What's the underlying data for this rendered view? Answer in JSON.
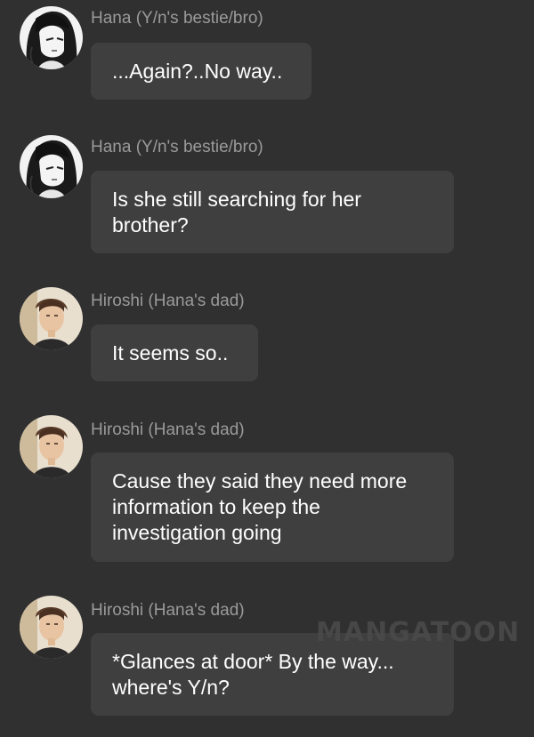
{
  "messages": [
    {
      "sender": "Hana (Y/n's bestie/bro)",
      "avatar_icon": "girl-avatar-icon",
      "text": "...Again?..No way.."
    },
    {
      "sender": "Hana (Y/n's bestie/bro)",
      "avatar_icon": "girl-avatar-icon",
      "text": "Is she still searching for her brother?"
    },
    {
      "sender": "Hiroshi (Hana's dad)",
      "avatar_icon": "man-avatar-icon",
      "text": "It seems so.."
    },
    {
      "sender": "Hiroshi (Hana's dad)",
      "avatar_icon": "man-avatar-icon",
      "text": "Cause they said they need more information to keep the investigation going"
    },
    {
      "sender": "Hiroshi (Hana's dad)",
      "avatar_icon": "man-avatar-icon",
      "text": "*Glances at door* By the way... where's Y/n?"
    }
  ],
  "watermark": "MANGATOON",
  "colors": {
    "background": "#303030",
    "bubble": "#3f3f3f",
    "sender_name": "#9a9a9a",
    "text": "#ffffff"
  }
}
